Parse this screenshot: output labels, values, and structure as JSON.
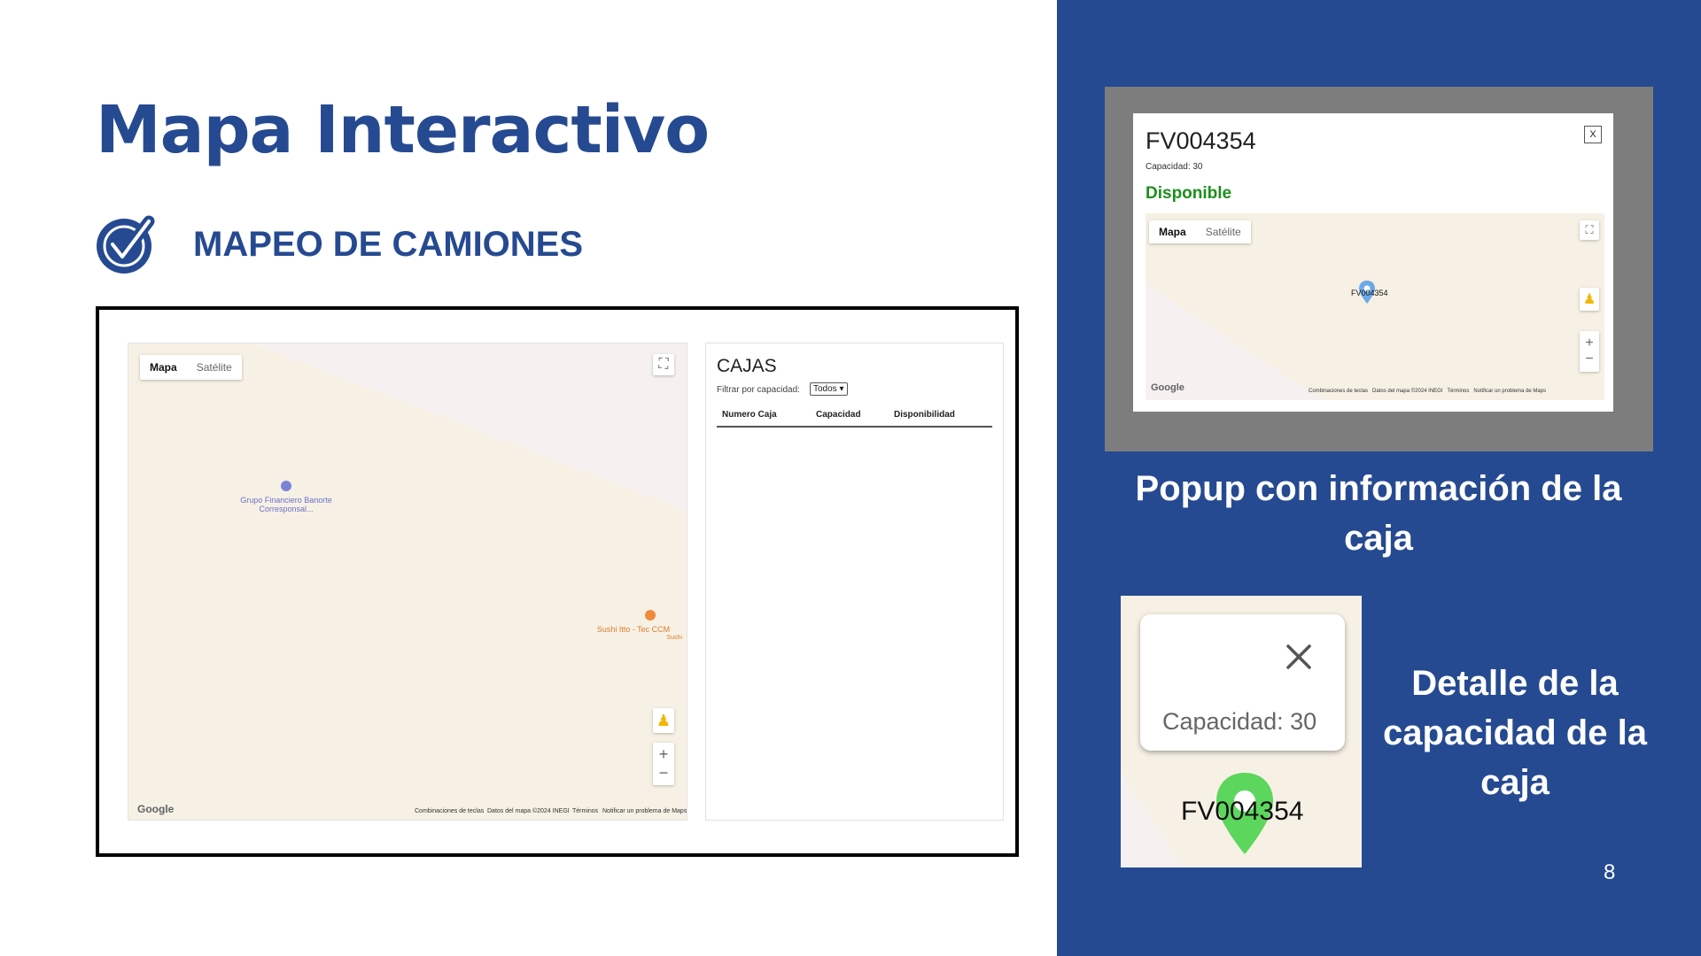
{
  "slide": {
    "title": "Mapa Interactivo",
    "subtitle": "MAPEO DE CAMIONES",
    "page_number": "8",
    "colors": {
      "brand_blue": "#264a91",
      "available_green": "#1d8f1d",
      "pin_green": "#5cd65c",
      "map_bg": "#f7f1e5"
    }
  },
  "app": {
    "map": {
      "tabs": [
        "Mapa",
        "Satélite"
      ],
      "active_tab": "Mapa",
      "pois": [
        {
          "name": "Grupo Financiero Banorte Corresponsal...",
          "icon": "bank-icon"
        },
        {
          "name": "Sushi Itto - Tec CCM",
          "category": "Sushi",
          "icon": "restaurant-icon"
        }
      ],
      "controls": [
        "fullscreen-icon",
        "pegman-icon",
        "zoom-in-icon",
        "zoom-out-icon"
      ],
      "logo": "Google",
      "attribution": {
        "shortcuts": "Combinaciones de teclas",
        "map_data": "Datos del mapa ©2024 INEGI",
        "terms": "Términos",
        "report": "Notificar un problema de Maps"
      }
    },
    "cajas": {
      "title": "CAJAS",
      "filter_label": "Filtrar por capacidad:",
      "filter_value": "Todos",
      "columns": [
        "Numero Caja",
        "Capacidad",
        "Disponibilidad"
      ],
      "rows": []
    }
  },
  "popup": {
    "id": "FV004354",
    "capacity": "Capacidad: 30",
    "status": "Disponible",
    "close": "X",
    "map_tabs": [
      "Mapa",
      "Satélite"
    ],
    "marker_label": "FV004354",
    "logo": "Google",
    "attribution": "Combinaciones de teclas   Datos del mapa ©2024 INEGI   Términos   Notificar un problema de Maps",
    "caption": "Popup con información de la caja"
  },
  "detail": {
    "capacity": "Capacidad: 30",
    "marker_label": "FV004354",
    "close_icon": "close-icon",
    "caption": "Detalle de la capacidad de la caja"
  }
}
